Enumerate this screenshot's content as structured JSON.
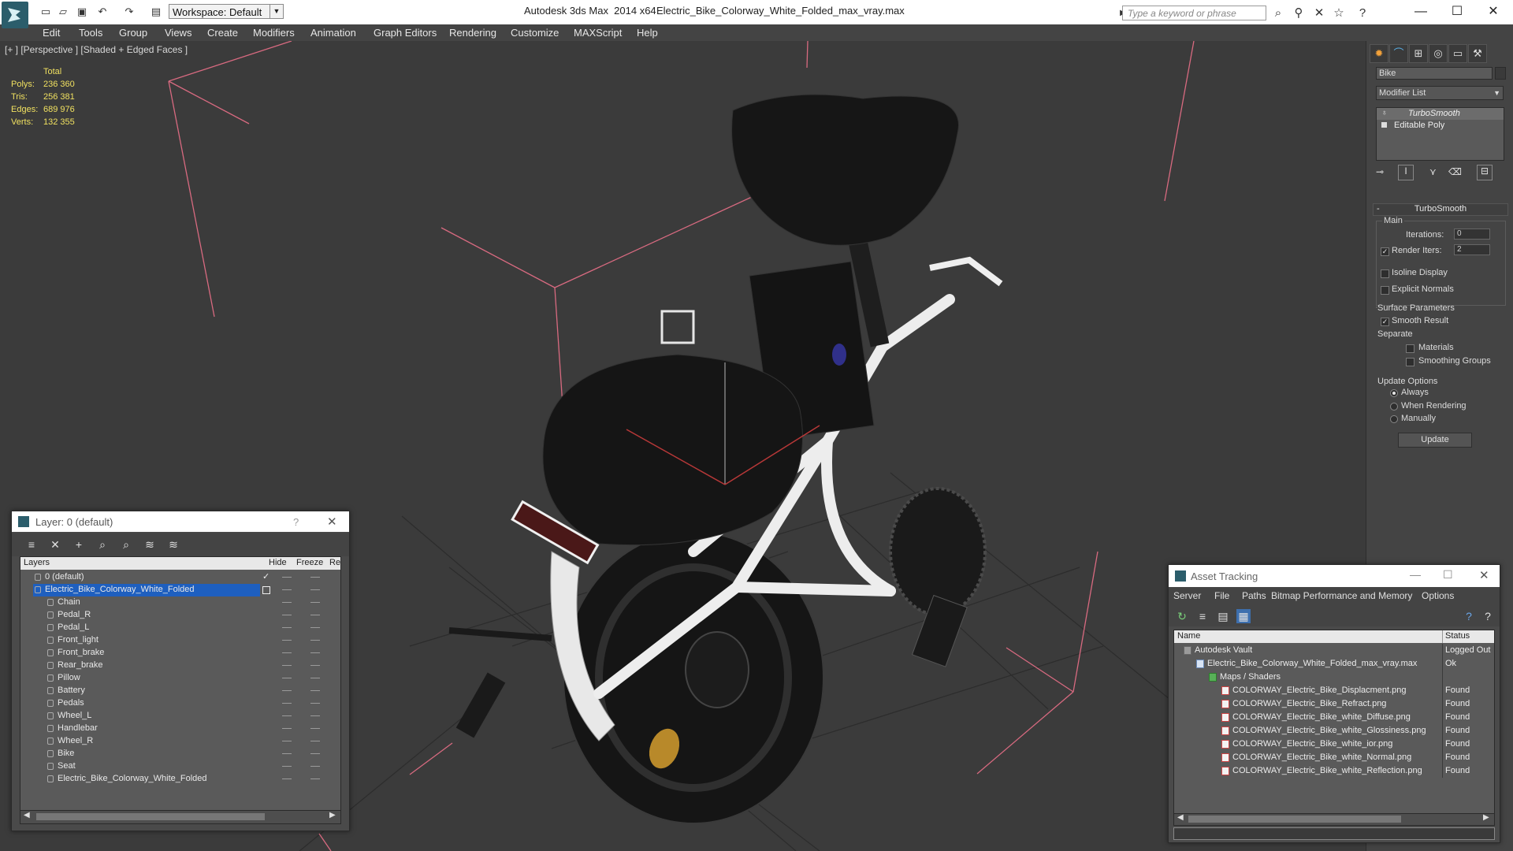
{
  "app": {
    "title": "Autodesk 3ds Max  2014 x64",
    "file": "Electric_Bike_Colorway_White_Folded_max_vray.max",
    "workspace": "Workspace: Default",
    "search_placeholder": "Type a keyword or phrase"
  },
  "menu": [
    "Edit",
    "Tools",
    "Group",
    "Views",
    "Create",
    "Modifiers",
    "Animation",
    "Graph Editors",
    "Rendering",
    "Customize",
    "MAXScript",
    "Help"
  ],
  "viewport": {
    "label": "[+ ] [Perspective ] [Shaded + Edged Faces ]",
    "stats": {
      "header": "Total",
      "rows": [
        {
          "k": "Polys:",
          "v": "236 360"
        },
        {
          "k": "Tris:",
          "v": "256 381"
        },
        {
          "k": "Edges:",
          "v": "689 976"
        },
        {
          "k": "Verts:",
          "v": "132 355"
        }
      ]
    }
  },
  "command_panel": {
    "object_name": "Bike",
    "modifier_list": "Modifier List",
    "stack": [
      "TurboSmooth",
      "Editable Poly"
    ],
    "rollout_title": "TurboSmooth",
    "main_label": "Main",
    "iterations_label": "Iterations:",
    "iterations_value": "0",
    "render_iters_label": "Render Iters:",
    "render_iters_value": "2",
    "isoline": "Isoline Display",
    "explicit_normals": "Explicit Normals",
    "surface_params": "Surface Parameters",
    "smooth_result": "Smooth Result",
    "separate": "Separate",
    "materials": "Materials",
    "smoothing_groups": "Smoothing Groups",
    "update_options": "Update Options",
    "always": "Always",
    "when_rendering": "When Rendering",
    "manually": "Manually",
    "update_button": "Update"
  },
  "layer_dialog": {
    "title": "Layer: 0 (default)",
    "help": "?",
    "columns": {
      "layers": "Layers",
      "hide": "Hide",
      "freeze": "Freeze",
      "render": "Re"
    },
    "rows": [
      {
        "name": "0 (default)",
        "level": 0
      },
      {
        "name": "Electric_Bike_Colorway_White_Folded",
        "level": 0,
        "selected": true
      },
      {
        "name": "Chain",
        "level": 1
      },
      {
        "name": "Pedal_R",
        "level": 1
      },
      {
        "name": "Pedal_L",
        "level": 1
      },
      {
        "name": "Front_light",
        "level": 1
      },
      {
        "name": "Front_brake",
        "level": 1
      },
      {
        "name": "Rear_brake",
        "level": 1
      },
      {
        "name": "Pillow",
        "level": 1
      },
      {
        "name": "Battery",
        "level": 1
      },
      {
        "name": "Pedals",
        "level": 1
      },
      {
        "name": "Wheel_L",
        "level": 1
      },
      {
        "name": "Handlebar",
        "level": 1
      },
      {
        "name": "Wheel_R",
        "level": 1
      },
      {
        "name": "Bike",
        "level": 1
      },
      {
        "name": "Seat",
        "level": 1
      },
      {
        "name": "Electric_Bike_Colorway_White_Folded",
        "level": 1
      }
    ]
  },
  "asset_tracking": {
    "title": "Asset Tracking",
    "menu": [
      "Server",
      "File",
      "Paths",
      "Bitmap Performance and Memory",
      "Options"
    ],
    "columns": {
      "name": "Name",
      "status": "Status"
    },
    "rows": [
      {
        "name": "Autodesk Vault",
        "status": "Logged Out",
        "level": 0
      },
      {
        "name": "Electric_Bike_Colorway_White_Folded_max_vray.max",
        "status": "Ok",
        "level": 1
      },
      {
        "name": "Maps / Shaders",
        "status": "",
        "level": 2
      },
      {
        "name": "COLORWAY_Electric_Bike_Displacment.png",
        "status": "Found",
        "level": 3
      },
      {
        "name": "COLORWAY_Electric_Bike_Refract.png",
        "status": "Found",
        "level": 3
      },
      {
        "name": "COLORWAY_Electric_Bike_white_Diffuse.png",
        "status": "Found",
        "level": 3
      },
      {
        "name": "COLORWAY_Electric_Bike_white_Glossiness.png",
        "status": "Found",
        "level": 3
      },
      {
        "name": "COLORWAY_Electric_Bike_white_ior.png",
        "status": "Found",
        "level": 3
      },
      {
        "name": "COLORWAY_Electric_Bike_white_Normal.png",
        "status": "Found",
        "level": 3
      },
      {
        "name": "COLORWAY_Electric_Bike_white_Reflection.png",
        "status": "Found",
        "level": 3
      }
    ]
  },
  "colors": {
    "selection": "#1e5fbf",
    "stats_text": "#f0e060",
    "grid_box": "#d86a80"
  }
}
